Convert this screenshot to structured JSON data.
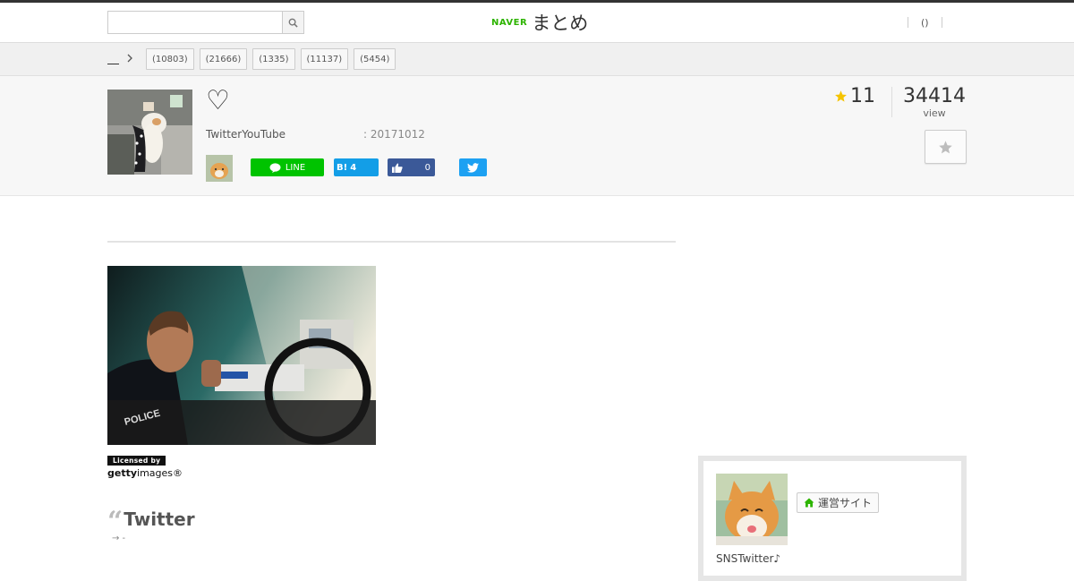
{
  "header": {
    "search_placeholder": "",
    "logo_brand": "NAVER",
    "logo_title": "まとめ",
    "link_paren": "()"
  },
  "breadcrumb": {
    "home_label": "",
    "tags": [
      "(10803)",
      "(21666)",
      "(1335)",
      "(11137)",
      "(5454)"
    ]
  },
  "article": {
    "title_icon": "♡",
    "description": "TwitterYouTube",
    "date_label": ": 20171012",
    "favorites": "11",
    "views": "34414",
    "views_label": "view",
    "share": {
      "line_label": "LINE",
      "hatena_label": "B!",
      "hatena_count": "4",
      "facebook_count": "0"
    }
  },
  "content": {
    "getty_licensed": "Licensed by",
    "getty_brand_bold": "getty",
    "getty_brand_rest": "images®",
    "quote_mark": "“",
    "quote_title": "Twitter",
    "quote_sub": "→ -"
  },
  "sidebar": {
    "site_button_label": "運営サイト",
    "site_description": "SNSTwitter♪"
  },
  "colors": {
    "accent_green": "#2db400",
    "line_green": "#00c300",
    "hatena_blue": "#139ee7",
    "facebook_blue": "#3b5998",
    "twitter_blue": "#1da1f2",
    "star_yellow": "#f5c400"
  },
  "icons": [
    "search-icon",
    "chevron-right-icon",
    "line-icon",
    "thumbs-up-icon",
    "twitter-bird-icon",
    "star-icon",
    "home-icon"
  ]
}
